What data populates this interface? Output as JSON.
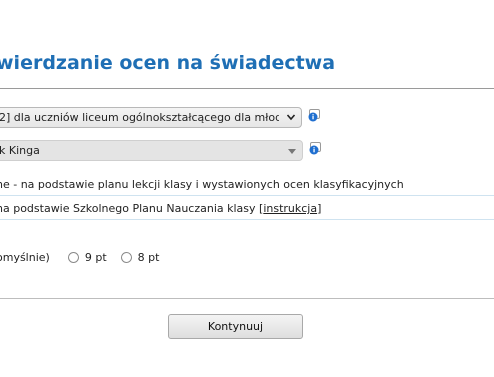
{
  "page": {
    "title": "wierdzanie ocen na świadectwa"
  },
  "form": {
    "class_select": {
      "value": "2] dla uczniów liceum ogólnokształcącego dla młodzie"
    },
    "student_select": {
      "value": "k Kinga"
    },
    "option_a": {
      "text": "ne - na podstawie planu lekcji klasy i wystawionych ocen klasyfikacyjnych"
    },
    "option_b": {
      "text": "na podstawie Szkolnego Planu Nauczania klasy [",
      "link": "instrukcja",
      "suffix": "]"
    },
    "font_size": {
      "default_label": "omyślnie)",
      "options": [
        "9 pt",
        "8 pt"
      ]
    },
    "continue_label": "Kontynuuj"
  },
  "icons": {
    "info_color": "#1f6fd0"
  }
}
